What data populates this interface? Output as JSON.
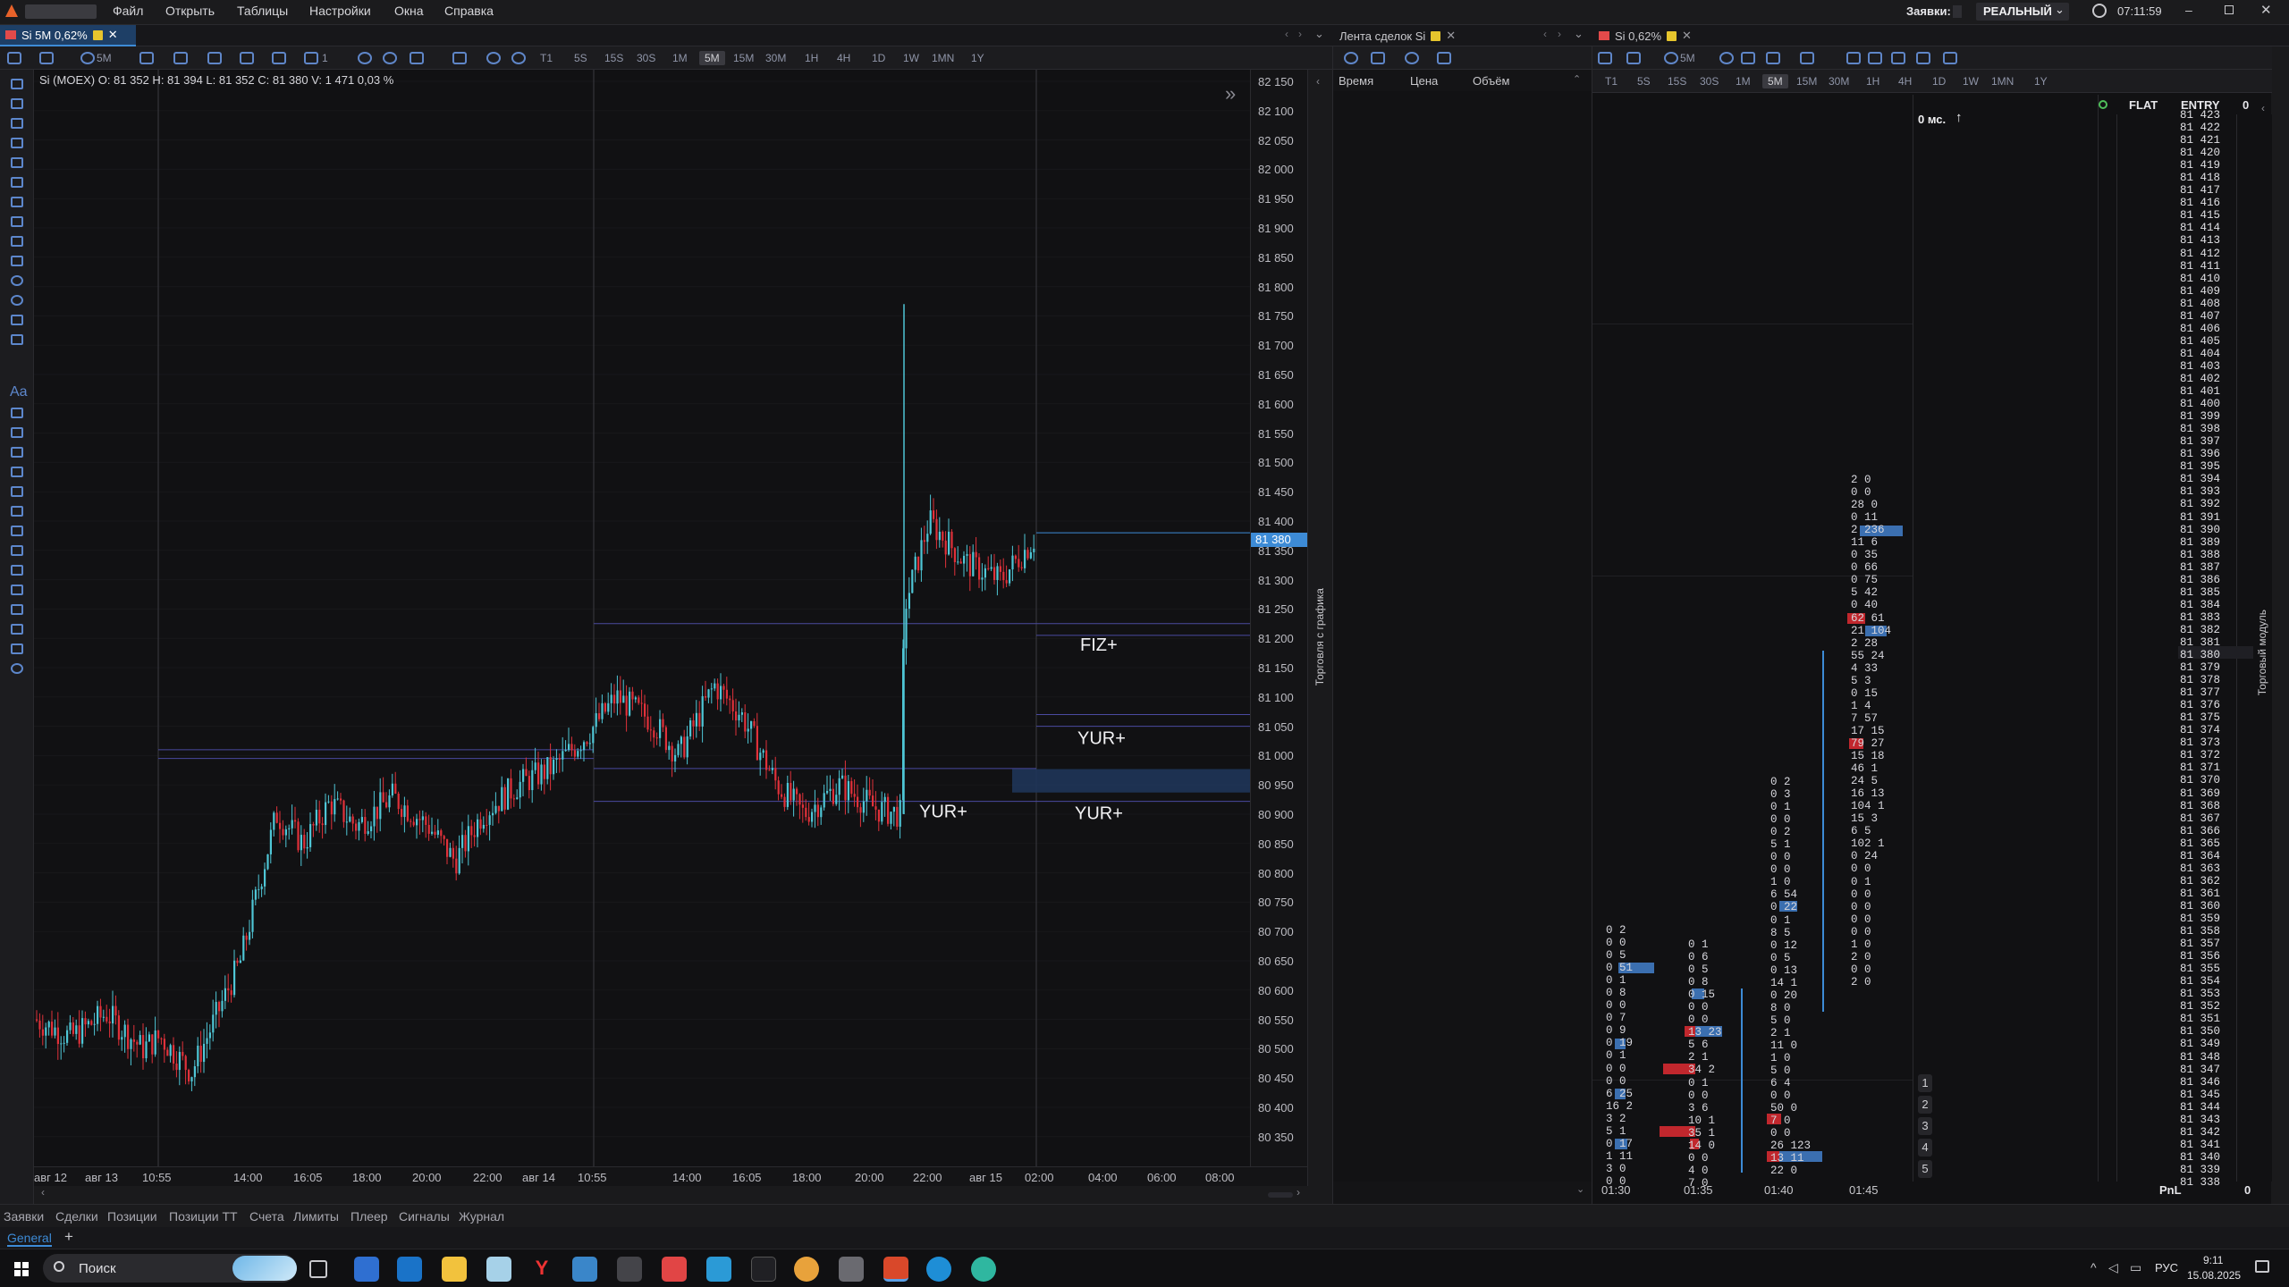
{
  "menubar": {
    "items": [
      "Файл",
      "Открыть",
      "Таблицы",
      "Настройки",
      "Окна",
      "Справка"
    ],
    "orders_label": "Заявки:",
    "mode_label": "РЕАЛЬНЫЙ",
    "clock": "07:11:59"
  },
  "tabs": {
    "chart_tab": "Si 5M 0,62%",
    "tape_tab": "Лента сделок Si",
    "dom_tab": "Si 0,62%"
  },
  "chart_toolbar": {
    "interval": "5M",
    "count": "1",
    "timeframes": [
      "T1",
      "5S",
      "15S",
      "30S",
      "1M",
      "5M",
      "15M",
      "30M",
      "1H",
      "4H",
      "1D",
      "1W",
      "1MN",
      "1Y"
    ],
    "active_timeframe": "5M"
  },
  "chart": {
    "ohlc": "Si (MOEX)  O: 81 352  H: 81 394  L: 81 352  C: 81 380  V: 1 471  0,03 %",
    "current_price": "81 380",
    "side_label": "Торговля с графика",
    "price_labels": [
      "82 150",
      "82 100",
      "82 050",
      "82 000",
      "81 950",
      "81 900",
      "81 850",
      "81 800",
      "81 750",
      "81 700",
      "81 650",
      "81 600",
      "81 550",
      "81 500",
      "81 450",
      "81 400",
      "81 350",
      "81 300",
      "81 250",
      "81 200",
      "81 150",
      "81 100",
      "81 050",
      "81 000",
      "80 950",
      "80 900",
      "80 850",
      "80 800",
      "80 750",
      "80 700",
      "80 650",
      "80 600",
      "80 550",
      "80 500",
      "80 450",
      "80 400",
      "80 350"
    ],
    "time_labels": [
      "авг 12",
      "авг 13",
      "10:55",
      "14:00",
      "16:05",
      "18:00",
      "20:00",
      "22:00",
      "авг 14",
      "10:55",
      "14:00",
      "16:05",
      "18:00",
      "20:00",
      "22:00",
      "авг 15",
      "02:00",
      "04:00",
      "06:00",
      "08:00"
    ],
    "annotations": [
      "FIZ+",
      "YUR+",
      "YUR+",
      "YUR+"
    ],
    "accent": "#3d8bd6",
    "up_color": "#4fc6d6",
    "down_color": "#e0313a"
  },
  "tape": {
    "columns": [
      "Время",
      "Цена",
      "Объём"
    ]
  },
  "dom": {
    "timeframes": [
      "T1",
      "5S",
      "15S",
      "30S",
      "1M",
      "5M",
      "15M",
      "30M",
      "1H",
      "4H",
      "1D",
      "1W",
      "1MN",
      "1Y"
    ],
    "active_timeframe": "5M",
    "interval": "5M",
    "latency": "0 мс.",
    "flat_label": "FLAT",
    "entry_label": "ENTRY",
    "entry_value": "0",
    "pnl_label": "PnL",
    "pnl_value": "0",
    "side_label": "Торговый модуль",
    "levels": [
      "1",
      "2",
      "3",
      "4",
      "5"
    ],
    "cluster_times": [
      "01:30",
      "01:35",
      "01:40",
      "01:45"
    ],
    "cluster1": "0 2\n0 0\n0 5\n0 51\n0 1\n0 8\n0 0\n0 7\n0 9\n0 19\n0 1\n0 0\n0 0\n6 25\n16 2\n3 2\n5 1\n0 17\n1 11\n3 0\n0 0",
    "cluster2": "0 1\n0 6\n0 5\n0 8\n0 15\n0 0\n0 0\n13 23\n5 6\n2 1\n34 2\n0 1\n0 0\n3 6\n10 1\n35 1\n14 0\n0 0\n4 0\n7 0",
    "cluster3": "0 2\n0 3\n0 1\n0 0\n0 2\n5 1\n0 0\n0 0\n1 0\n6 54\n0 22\n0 1\n8 5\n0 12\n0 5\n0 13\n14 1\n0 20\n8 0\n5 0\n2 1\n11 0\n1 0\n5 0\n6 4\n0 0\n50 0\n7 0\n0 0\n26 123\n13 11\n22 0",
    "cluster4": "2 0\n0 0\n28 0\n0 11\n2 236\n11 6\n0 35\n0 66\n0 75\n5 42\n0 40\n62 61\n21 104\n2 28\n55 24\n4 33\n5 3\n0 15\n1 4\n7 57\n17 15\n79 27\n15 18\n46 1\n24 5\n16 13\n104 1\n15 3\n6 5\n102 1\n0 24\n0 0\n0 1\n0 0\n0 0\n0 0\n0 0\n1 0\n2 0\n0 0\n2 0",
    "ladder_text": "81 423\n81 422\n81 421\n81 420\n81 419\n81 418\n81 417\n81 416\n81 415\n81 414\n81 413\n81 412\n81 411\n81 410\n81 409\n81 408\n81 407\n81 406\n81 405\n81 404\n81 403\n81 402\n81 401\n81 400\n81 399\n81 398\n81 397\n81 396\n81 395\n81 394\n81 393\n81 392\n81 391\n81 390\n81 389\n81 388\n81 387\n81 386\n81 385\n81 384\n81 383\n81 382\n81 381\n81 380\n81 379\n81 378\n81 377\n81 376\n81 375\n81 374\n81 373\n81 372\n81 371\n81 370\n81 369\n81 368\n81 367\n81 366\n81 365\n81 364\n81 363\n81 362\n81 361\n81 360\n81 359\n81 358\n81 357\n81 356\n81 355\n81 354\n81 353\n81 352\n81 351\n81 350\n81 349\n81 348\n81 347\n81 346\n81 345\n81 344\n81 343\n81 342\n81 341\n81 340\n81 339\n81 338"
  },
  "bottom_tabs": [
    "Заявки",
    "Сделки",
    "Позиции",
    "Позиции ТТ",
    "Счета",
    "Лимиты",
    "Плеер",
    "Сигналы",
    "Журнал"
  ],
  "workspace_tab": "General",
  "taskbar": {
    "search": "Поиск",
    "lang": "РУС",
    "time": "9:11",
    "date": "15.08.2025"
  }
}
